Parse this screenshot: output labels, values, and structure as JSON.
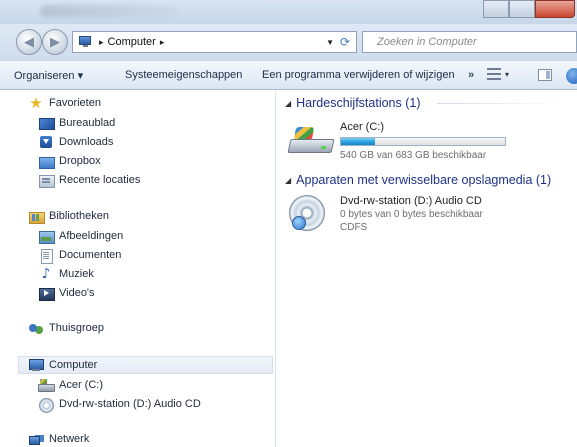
{
  "window": {
    "address": {
      "crumbs": [
        "Computer"
      ],
      "separator": "▸"
    },
    "search": {
      "placeholder": "Zoeken in Computer"
    }
  },
  "toolbar": {
    "organize_label": "Organiseren ▾",
    "properties_label": "Systeemeigenschappen",
    "uninstall_label": "Een programma verwijderen of wijzigen",
    "more_label": "»",
    "views_arrow": "▾"
  },
  "sidebar": {
    "favorites": {
      "label": "Favorieten",
      "items": [
        {
          "label": "Bureaublad",
          "icon": "desktop-icon"
        },
        {
          "label": "Downloads",
          "icon": "downloads-icon"
        },
        {
          "label": "Dropbox",
          "icon": "dropbox-icon"
        },
        {
          "label": "Recente locaties",
          "icon": "recent-places-icon"
        }
      ]
    },
    "libraries": {
      "label": "Bibliotheken",
      "items": [
        {
          "label": "Afbeeldingen",
          "icon": "pictures-icon"
        },
        {
          "label": "Documenten",
          "icon": "documents-icon"
        },
        {
          "label": "Muziek",
          "icon": "music-icon"
        },
        {
          "label": "Video's",
          "icon": "videos-icon"
        }
      ]
    },
    "homegroup": {
      "label": "Thuisgroep"
    },
    "computer": {
      "label": "Computer",
      "selected": true,
      "items": [
        {
          "label": "Acer (C:)",
          "icon": "drive-icon"
        },
        {
          "label": "Dvd-rw-station (D:) Audio CD",
          "icon": "dvd-icon"
        }
      ]
    },
    "network": {
      "label": "Netwerk"
    }
  },
  "content": {
    "groups": [
      {
        "header": "Hardeschijfstations (1)",
        "items": [
          {
            "name": "Acer (C:)",
            "detail": "540 GB van 683 GB beschikbaar",
            "used_fraction": 0.21,
            "icon": "hard-drive-icon"
          }
        ]
      },
      {
        "header": "Apparaten met verwisselbare opslagmedia (1)",
        "items": [
          {
            "name": "Dvd-rw-station (D:) Audio CD",
            "detail": "0 bytes van 0 bytes beschikbaar",
            "filesystem": "CDFS",
            "icon": "dvd-drive-icon"
          }
        ]
      }
    ]
  },
  "colors": {
    "group_header": "#1e3287",
    "capacity_bar": "#2aa2df",
    "selection": "#e4ebf5"
  }
}
